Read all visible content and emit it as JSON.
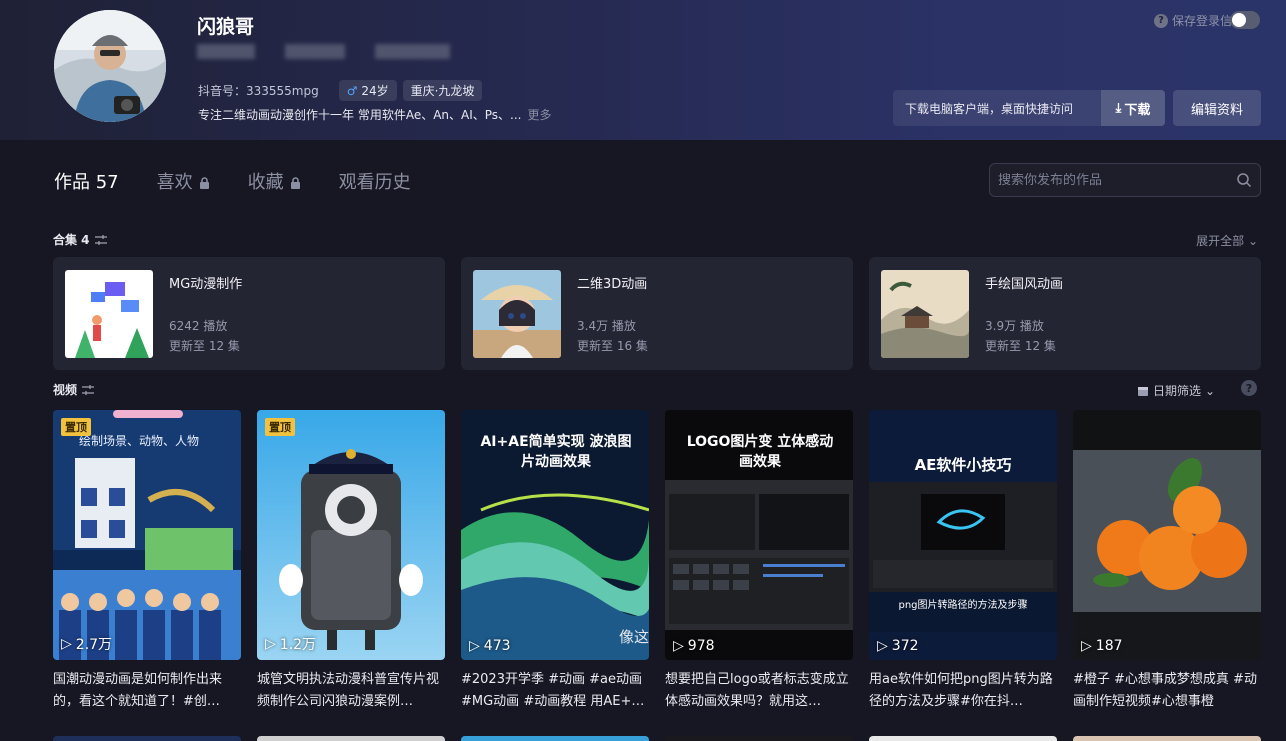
{
  "profile": {
    "name": "闪狼哥",
    "douyin_id": "抖音号：333555mpg",
    "age": "24岁",
    "location": "重庆·九龙坡",
    "bio": "专注二维动画动漫创作十一年 常用软件Ae、An、AI、Ps、...",
    "more": "更多"
  },
  "header": {
    "save_login": "保存登录信息",
    "download_text": "下载电脑客户端，桌面快捷访问",
    "download_btn": "下载",
    "edit_btn": "编辑资料"
  },
  "tabs": [
    {
      "label": "作品 57"
    },
    {
      "label": "喜欢"
    },
    {
      "label": "收藏"
    },
    {
      "label": "观看历史"
    }
  ],
  "search": {
    "placeholder": "搜索你发布的作品"
  },
  "collections": {
    "title": "合集 4",
    "expand": "展开全部",
    "items": [
      {
        "name": "MG动漫制作",
        "plays": "6242 播放",
        "updated": "更新至 12 集"
      },
      {
        "name": "二维3D动画",
        "plays": "3.4万 播放",
        "updated": "更新至 16 集"
      },
      {
        "name": "手绘国风动画",
        "plays": "3.9万 播放",
        "updated": "更新至 12 集"
      }
    ]
  },
  "videos": {
    "title": "视频",
    "date_filter": "日期筛选",
    "items": [
      {
        "plays": "2.7万",
        "pinned": "置顶",
        "title": "国潮动漫动画是如何制作出来的，看这个就知道了！#创…",
        "overlay": "绘制场景、动物、人物"
      },
      {
        "plays": "1.2万",
        "pinned": "置顶",
        "title": "城管文明执法动漫科普宣传片视频制作公司闪狼动漫案例…"
      },
      {
        "plays": "473",
        "title": "#2023开学季 #动画 #ae动画 #MG动画 #动画教程 用AE+…",
        "overlay": "AI+AE简单实现 波浪图片动画效果",
        "overlay2": "像这"
      },
      {
        "plays": "978",
        "title": "想要把自己logo或者标志变成立体感动画效果吗？就用这…",
        "overlay": "LOGO图片变 立体感动画效果"
      },
      {
        "plays": "372",
        "title": "用ae软件如何把png图片转为路径的方法及步骤#你在抖…",
        "overlay": "AE软件小技巧",
        "overlay2": "png图片转路径的方法及步骤"
      },
      {
        "plays": "187",
        "title": "#橙子 #心想事成梦想成真 #动画制作短视频#心想事橙"
      }
    ]
  }
}
